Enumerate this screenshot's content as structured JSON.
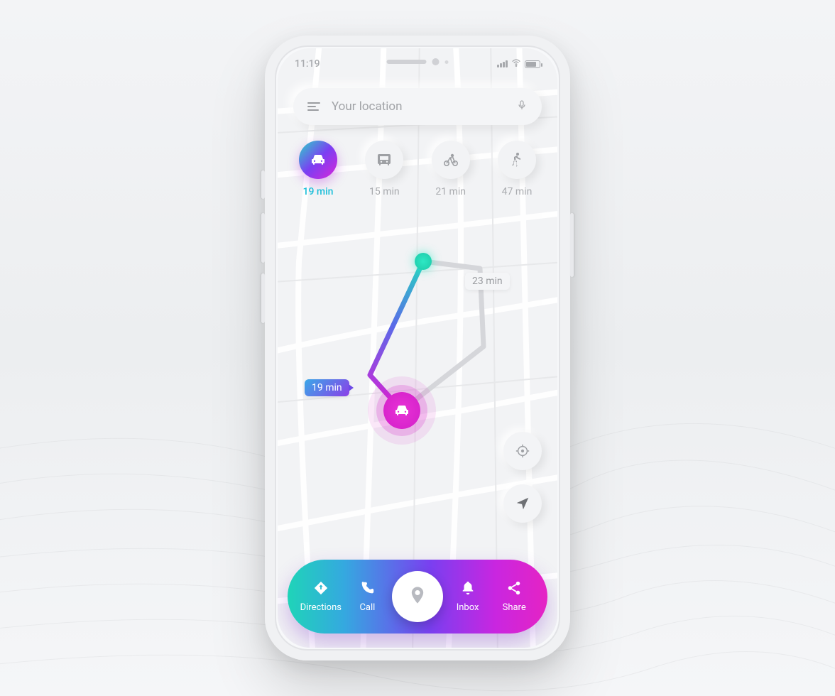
{
  "status": {
    "time": "11:19"
  },
  "search": {
    "placeholder": "Your location"
  },
  "modes": {
    "car": {
      "label": "19 min",
      "active": true
    },
    "bus": {
      "label": "15 min",
      "active": false
    },
    "bike": {
      "label": "21 min",
      "active": false
    },
    "walk": {
      "label": "47 min",
      "active": false
    }
  },
  "route": {
    "primary_time": "19 min",
    "alt_time": "23 min"
  },
  "nav": {
    "directions": "Directions",
    "call": "Call",
    "inbox": "Inbox",
    "share": "Share"
  }
}
